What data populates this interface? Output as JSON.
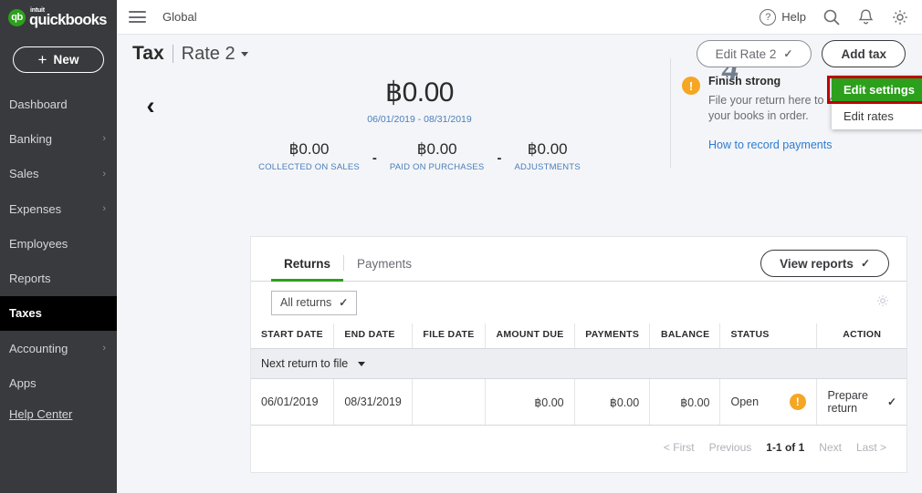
{
  "sidebar": {
    "logo": {
      "intuit": "intuit",
      "brand": "quickbooks",
      "mark": "qb"
    },
    "new_button": "New",
    "items": [
      {
        "label": "Dashboard",
        "chevron": ""
      },
      {
        "label": "Banking",
        "chevron": "›"
      },
      {
        "label": "Sales",
        "chevron": "›"
      },
      {
        "label": "Expenses",
        "chevron": "›"
      },
      {
        "label": "Employees",
        "chevron": ""
      },
      {
        "label": "Reports",
        "chevron": ""
      },
      {
        "label": "Taxes",
        "chevron": ""
      },
      {
        "label": "Accounting",
        "chevron": "›"
      },
      {
        "label": "Apps",
        "chevron": ""
      }
    ],
    "help_center": "Help Center"
  },
  "topbar": {
    "company": "Global",
    "help_label": "Help",
    "help_mark": "?"
  },
  "page_header": {
    "title": "Tax",
    "rate_selector": "Rate 2",
    "edit_rate_button": "Edit Rate 2",
    "add_tax_button": "Add tax"
  },
  "dropdown": {
    "items": [
      {
        "label": "Edit settings",
        "highlighted": true
      },
      {
        "label": "Edit rates",
        "highlighted": false
      }
    ]
  },
  "summary": {
    "total_amount": "฿0.00",
    "date_range": "06/01/2019 - 08/31/2019",
    "breakdown": [
      {
        "amount": "฿0.00",
        "label": "COLLECTED ON SALES"
      },
      {
        "amount": "฿0.00",
        "label": "PAID ON PURCHASES"
      },
      {
        "amount": "฿0.00",
        "label": "ADJUSTMENTS"
      }
    ],
    "operator": "-",
    "prev_arrow": "‹",
    "next_arrow": "›"
  },
  "notice": {
    "deco_number": "4",
    "warn_mark": "!",
    "title": "Finish strong",
    "text": "File your return here to keep your books in order.",
    "link": "How to record payments"
  },
  "card": {
    "tabs": [
      {
        "label": "Returns",
        "active": true
      },
      {
        "label": "Payments",
        "active": false
      }
    ],
    "view_reports_button": "View reports",
    "filter_select": "All returns",
    "columns": [
      "START DATE",
      "END DATE",
      "FILE DATE",
      "AMOUNT DUE",
      "PAYMENTS",
      "BALANCE",
      "STATUS",
      "",
      "ACTION"
    ],
    "group_row": "Next return to file",
    "rows": [
      {
        "start_date": "06/01/2019",
        "end_date": "08/31/2019",
        "file_date": "",
        "amount_due": "฿0.00",
        "payments": "฿0.00",
        "balance": "฿0.00",
        "status": "Open",
        "status_mark": "!",
        "action": "Prepare return"
      }
    ],
    "pagination": {
      "first": "< First",
      "previous": "Previous",
      "current": "1-1 of 1",
      "next": "Next",
      "last": "Last >"
    }
  },
  "colors": {
    "brand_green": "#2ca01c",
    "highlight_red": "#c00000",
    "sidebar_bg": "#393a3d",
    "active_nav_bg": "#000000",
    "link_blue": "#2b7cd3",
    "label_blue": "#4a7ebb",
    "warning_orange": "#f5a623"
  }
}
